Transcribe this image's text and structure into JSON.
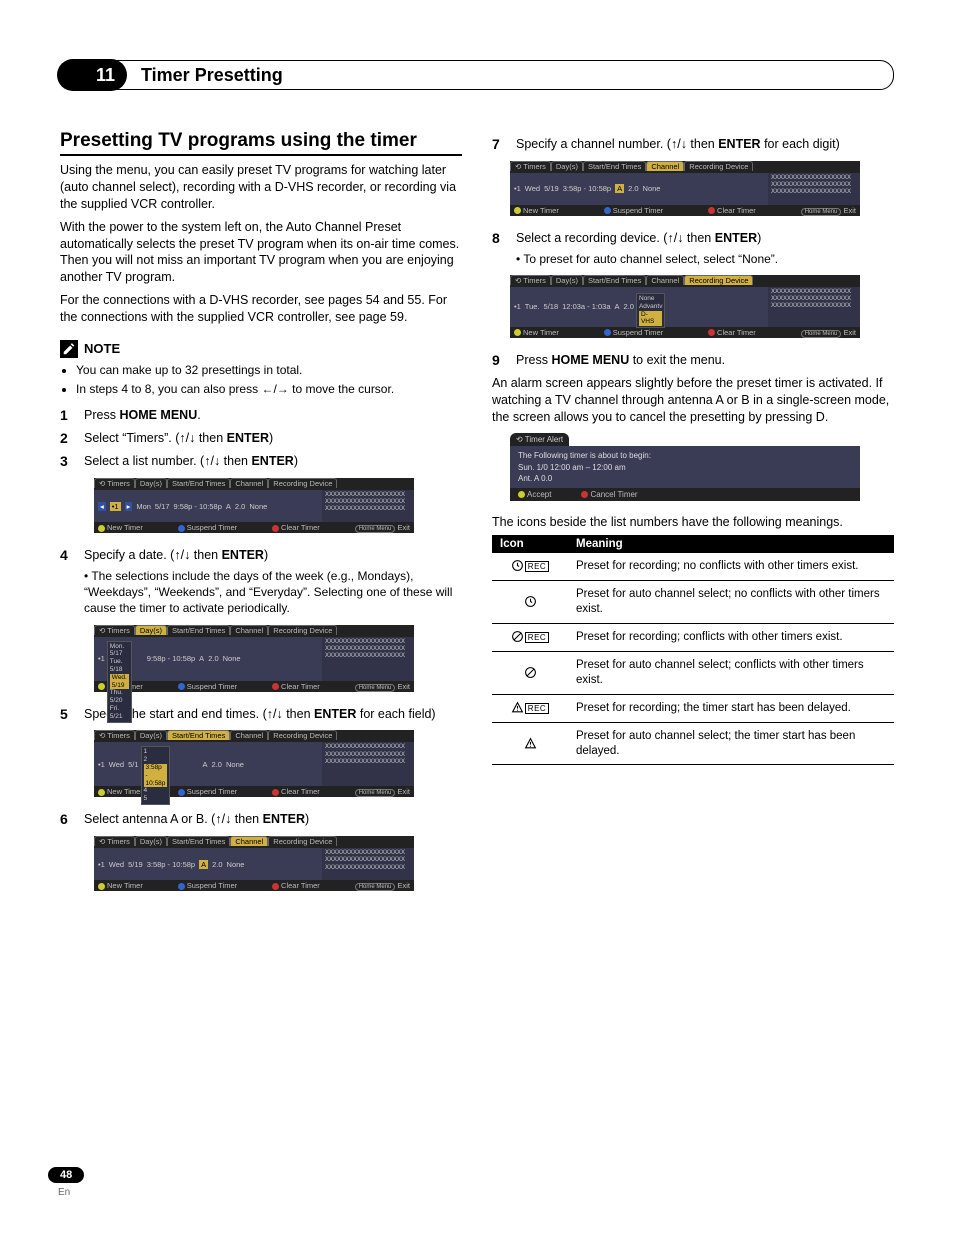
{
  "chapter": {
    "number": "11",
    "title": "Timer Presetting"
  },
  "section": {
    "title": "Presetting TV programs using the timer"
  },
  "intro": {
    "p1": "Using the menu, you can easily preset TV programs for watching later (auto channel select), recording with a D-VHS recorder, or recording via the supplied VCR controller.",
    "p2": "With the power to the system left on, the Auto Channel Preset automatically selects the preset TV program when its on-air time comes. Then you will not miss an important TV program when you are enjoying another TV program.",
    "p3": "For the connections with a D-VHS recorder, see pages 54 and 55. For the connections with the supplied VCR controller, see page 59."
  },
  "note": {
    "label": "NOTE",
    "items": [
      "You can make up to 32 presettings in total.",
      "In steps 4 to 8, you can also press ←/→ to move the cursor."
    ]
  },
  "steps": {
    "s1": {
      "pre": "Press ",
      "bold": "HOME MENU",
      "post": "."
    },
    "s2": {
      "pre": "Select “Timers”. (",
      "bold": "ENTER",
      "post": ")"
    },
    "s3": {
      "pre": "Select a list number. (",
      "bold": "ENTER",
      "post": ")"
    },
    "s4": {
      "pre": "Specify a date. (",
      "bold": "ENTER",
      "post": ")",
      "sub": "The selections include the days of the week (e.g., Mondays), “Weekdays”, “Weekends”, and “Everyday”. Selecting one of these will cause the timer to activate periodically."
    },
    "s5": {
      "pre": "Specify the start and end times. (",
      "bold": "ENTER",
      "post": " for each field)"
    },
    "s6": {
      "pre": "Select antenna A or B. (",
      "bold": "ENTER",
      "post": ")"
    },
    "s7": {
      "pre": "Specify a channel number. (",
      "bold": "ENTER",
      "post": " for each digit)"
    },
    "s8": {
      "pre": "Select a recording device. (",
      "bold": "ENTER",
      "post": ")",
      "sub": "To preset for auto channel select, select “None”."
    },
    "s9": {
      "pre": "Press ",
      "bold": "HOME MENU",
      "post": " to exit the menu."
    }
  },
  "osd": {
    "headers": {
      "timers": "Timers",
      "days": "Day(s)",
      "startend": "Start/End Times",
      "channel": "Channel",
      "recdev": "Recording Device"
    },
    "foot": {
      "new": "New Timer",
      "suspend": "Suspend Timer",
      "clear": "Clear Timer",
      "home": "Home Menu",
      "exit": "Exit"
    },
    "xrow": "XXXXXXXXXXXXXXXXXXXX",
    "r3": {
      "idx": "•1",
      "day": "Mon",
      "date": "5/17",
      "time": "9:58p - 10:58p",
      "ant": "A",
      "ch": "2.0",
      "dev": "None"
    },
    "r4": {
      "idx": "•1",
      "day": "Wed.",
      "date": "5/19",
      "time": "9:58p - 10:58p",
      "ant": "A",
      "ch": "2.0",
      "dev": "None",
      "dd": [
        "Mon.  5/17",
        "Tue.   5/18",
        "Wed.  5/19",
        "Thu.   5/20",
        "Fri.    5/21"
      ]
    },
    "r5": {
      "idx": "•1",
      "day": "Wed",
      "date": "5/1",
      "time": "3:58p - 10:58p",
      "ant": "A",
      "ch": "2.0",
      "dev": "None",
      "dd": [
        "1",
        "2",
        "3:58p - 10:58p",
        "4",
        "5"
      ]
    },
    "r6": {
      "idx": "•1",
      "day": "Wed",
      "date": "5/19",
      "time": "3:58p - 10:58p",
      "ant": "A",
      "ch": "2.0",
      "dev": "None"
    },
    "r7": {
      "idx": "•1",
      "day": "Wed",
      "date": "5/19",
      "time": "3:58p - 10:58p",
      "ant": "A",
      "ch": "2.0",
      "dev": "None"
    },
    "r8": {
      "idx": "•1",
      "day": "Tue.",
      "date": "5/18",
      "time": "12:03a - 1:03a",
      "ant": "A",
      "ch": "2.0",
      "dev": "D-VHS",
      "dd": [
        "None",
        "Advantv",
        "D-VHS"
      ]
    }
  },
  "after9": "An alarm screen appears slightly before the preset timer is activated. If watching a TV channel through antenna A or B in a single-screen mode, the screen allows you to cancel the presetting by pressing D.",
  "alert": {
    "title": "Timer Alert",
    "l1": "The Following timer is about to begin:",
    "l2": "Sun. 1/0  12:00 am – 12:00 am",
    "l3": "Ant. A 0.0",
    "accept": "Accept",
    "cancel": "Cancel Timer"
  },
  "meaningsIntro": "The icons beside the list numbers have the following meanings.",
  "meaningsHead": {
    "icon": "Icon",
    "meaning": "Meaning"
  },
  "meanings": [
    "Preset for recording; no conflicts with other timers exist.",
    "Preset for auto channel select; no conflicts with other timers exist.",
    "Preset for recording; conflicts with other timers exist.",
    "Preset for auto channel select; conflicts with other timers exist.",
    "Preset for recording; the timer start has been delayed.",
    "Preset for auto channel select; the timer start has been delayed."
  ],
  "recLabel": "REC",
  "pageNumber": "48",
  "pageLang": "En"
}
